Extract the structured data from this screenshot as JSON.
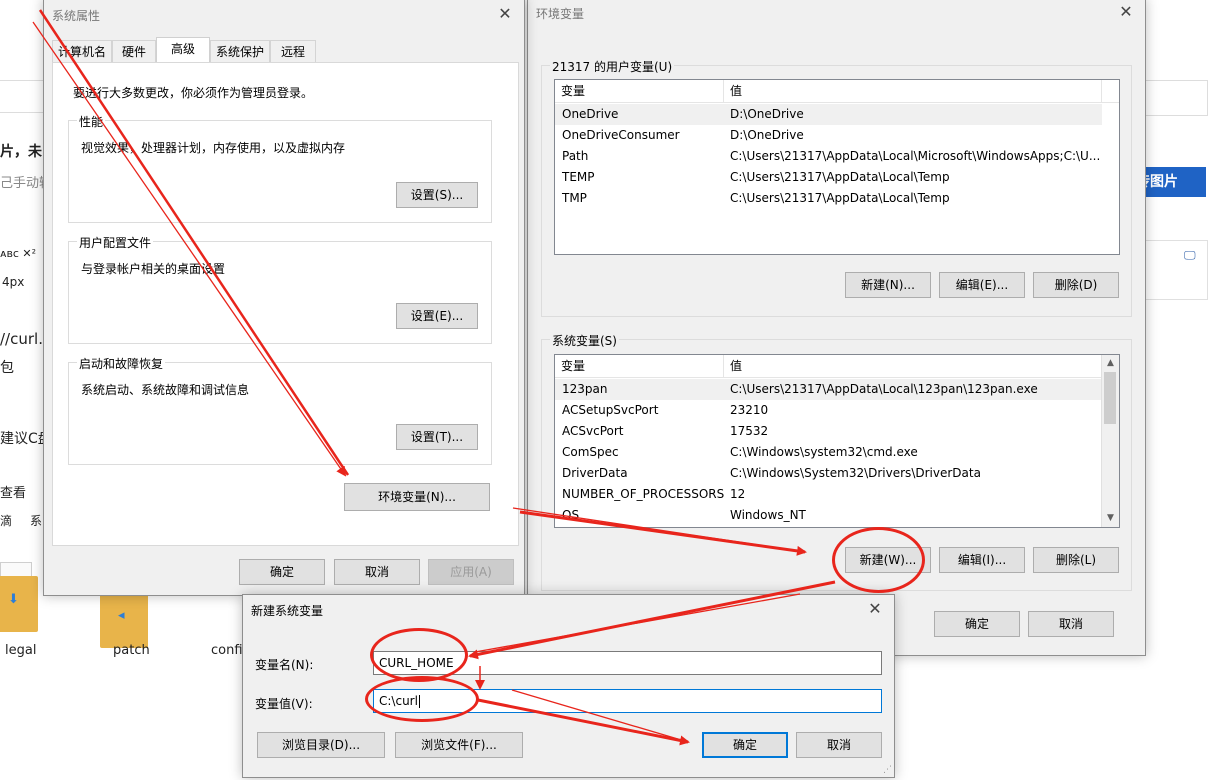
{
  "background": {
    "texts": [
      "片，未i",
      "己手动输",
      "4px",
      "//curl.s",
      "包",
      "建议C盘",
      "查看",
      "滴",
      "系"
    ],
    "upload_button": "传图片",
    "folders": [
      "legal",
      "patch",
      "config"
    ]
  },
  "sysprops": {
    "title": "系统属性",
    "tabs": [
      "计算机名",
      "硬件",
      "高级",
      "系统保护",
      "远程"
    ],
    "admin_note": "要进行大多数更改，你必须作为管理员登录。",
    "perf": {
      "title": "性能",
      "desc": "视觉效果，处理器计划，内存使用，以及虚拟内存",
      "button": "设置(S)..."
    },
    "profile": {
      "title": "用户配置文件",
      "desc": "与登录帐户相关的桌面设置",
      "button": "设置(E)..."
    },
    "startup": {
      "title": "启动和故障恢复",
      "desc": "系统启动、系统故障和调试信息",
      "button": "设置(T)..."
    },
    "env_button": "环境变量(N)...",
    "ok": "确定",
    "cancel": "取消",
    "apply": "应用(A)"
  },
  "envvars": {
    "title": "环境变量",
    "user_group": "21317 的用户变量(U)",
    "col_var": "变量",
    "col_val": "值",
    "user_vars": [
      {
        "name": "OneDrive",
        "value": "D:\\OneDrive"
      },
      {
        "name": "OneDriveConsumer",
        "value": "D:\\OneDrive"
      },
      {
        "name": "Path",
        "value": "C:\\Users\\21317\\AppData\\Local\\Microsoft\\WindowsApps;C:\\U..."
      },
      {
        "name": "TEMP",
        "value": "C:\\Users\\21317\\AppData\\Local\\Temp"
      },
      {
        "name": "TMP",
        "value": "C:\\Users\\21317\\AppData\\Local\\Temp"
      }
    ],
    "user_new": "新建(N)...",
    "user_edit": "编辑(E)...",
    "user_delete": "删除(D)",
    "sys_group": "系统变量(S)",
    "sys_vars": [
      {
        "name": "123pan",
        "value": "C:\\Users\\21317\\AppData\\Local\\123pan\\123pan.exe"
      },
      {
        "name": "ACSetupSvcPort",
        "value": "23210"
      },
      {
        "name": "ACSvcPort",
        "value": "17532"
      },
      {
        "name": "ComSpec",
        "value": "C:\\Windows\\system32\\cmd.exe"
      },
      {
        "name": "DriverData",
        "value": "C:\\Windows\\System32\\Drivers\\DriverData"
      },
      {
        "name": "NUMBER_OF_PROCESSORS",
        "value": "12"
      },
      {
        "name": "OS",
        "value": "Windows_NT"
      }
    ],
    "sys_new": "新建(W)...",
    "sys_edit": "编辑(I)...",
    "sys_delete": "删除(L)",
    "ok": "确定",
    "cancel": "取消"
  },
  "newvar": {
    "title": "新建系统变量",
    "name_label": "变量名(N):",
    "name_value": "CURL_HOME",
    "value_label": "变量值(V):",
    "value_value": "C:\\curl",
    "browse_dir": "浏览目录(D)...",
    "browse_file": "浏览文件(F)...",
    "ok": "确定",
    "cancel": "取消"
  },
  "colors": {
    "annotation_red": "#e8251c",
    "focus_blue": "#0078d7",
    "upload_blue": "#1f63c5"
  }
}
